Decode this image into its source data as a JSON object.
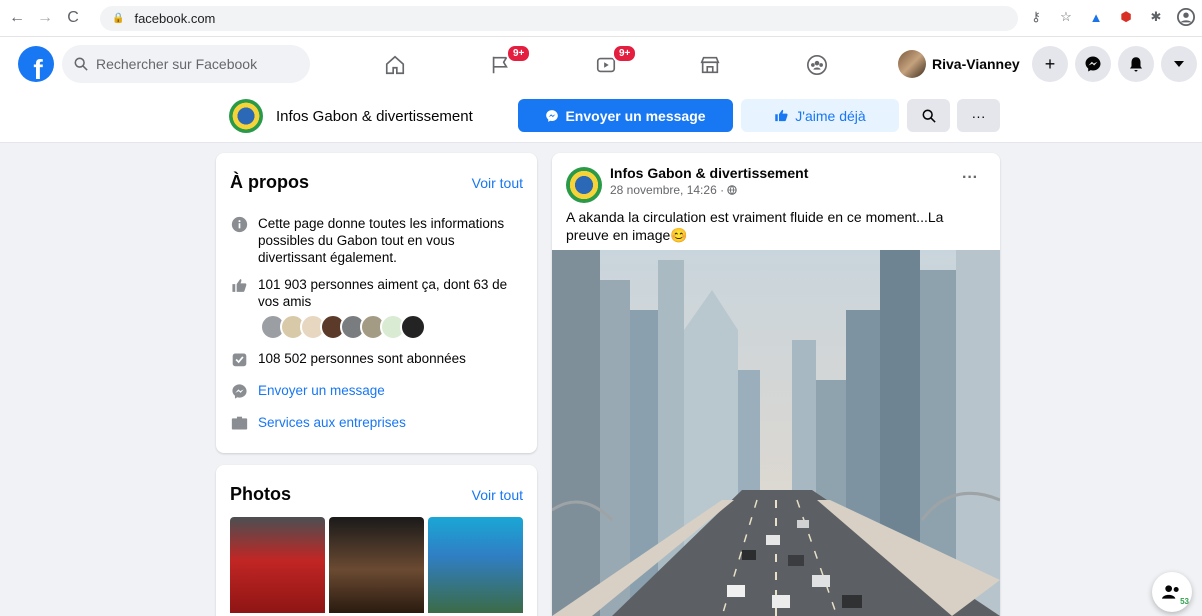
{
  "browser": {
    "url": "facebook.com"
  },
  "nav": {
    "search_placeholder": "Rechercher sur Facebook",
    "pages_badge": "9+",
    "watch_badge": "9+",
    "profile_name": "Riva-Vianney"
  },
  "page_header": {
    "name": "Infos Gabon & divertissement",
    "message_button": "Envoyer un message",
    "like_button": "J'aime déjà"
  },
  "about": {
    "title": "À propos",
    "see_all": "Voir tout",
    "description": "Cette page donne toutes les informations possibles du Gabon tout en vous divertissant également.",
    "likes": "101 903 personnes aiment ça, dont 63 de vos amis",
    "followers": "108 502 personnes sont abonnées",
    "send_message": "Envoyer un message",
    "business_services": "Services aux entreprises"
  },
  "photos": {
    "title": "Photos",
    "see_all": "Voir tout"
  },
  "post": {
    "author": "Infos Gabon & divertissement",
    "time": "28 novembre, 14:26 · ",
    "text": "A akanda la circulation est vraiment fluide en ce moment...La preuve en image😊"
  },
  "contacts": {
    "count": "53"
  },
  "colors": {
    "brand": "#1877f2",
    "badge": "#e41e3f"
  }
}
